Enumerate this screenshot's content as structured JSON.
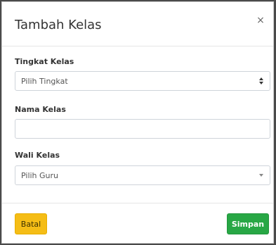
{
  "modal": {
    "title": "Tambah Kelas",
    "close_glyph": "×"
  },
  "form": {
    "tingkat": {
      "label": "Tingkat Kelas",
      "selected": "Pilih Tingkat"
    },
    "nama": {
      "label": "Nama Kelas",
      "value": ""
    },
    "wali": {
      "label": "Wali Kelas",
      "selected": "Pilih Guru"
    }
  },
  "footer": {
    "cancel_label": "Batal",
    "save_label": "Simpan"
  },
  "colors": {
    "cancel_bg": "#f5bd16",
    "save_bg": "#28a745"
  },
  "icons": {
    "close": "close-icon",
    "select_updown": "updown-arrows-icon",
    "dropdown": "chevron-down-icon"
  }
}
